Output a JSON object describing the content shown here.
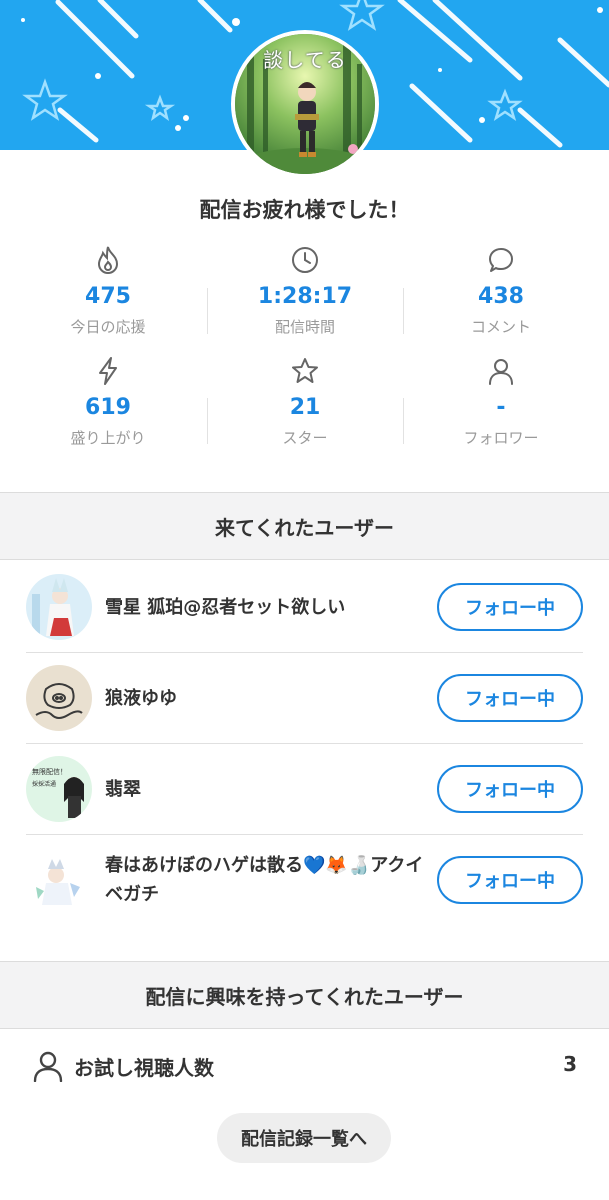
{
  "header": {
    "avatar_caption": "談してる",
    "title": "配信お疲れ様でした！"
  },
  "stats": [
    {
      "icon": "flame-icon",
      "value": "475",
      "label": "今日の応援"
    },
    {
      "icon": "clock-icon",
      "value": "1:28:17",
      "label": "配信時間"
    },
    {
      "icon": "comment-icon",
      "value": "438",
      "label": "コメント"
    },
    {
      "icon": "lightning-icon",
      "value": "619",
      "label": "盛り上がり"
    },
    {
      "icon": "star-icon",
      "value": "21",
      "label": "スター"
    },
    {
      "icon": "person-icon",
      "value": "-",
      "label": "フォロワー"
    }
  ],
  "visitors_section": {
    "title": "来てくれたユーザー",
    "users": [
      {
        "name": "雪星 狐珀@忍者セット欲しい",
        "button": "フォロー中"
      },
      {
        "name": "狼液ゆゆ",
        "button": "フォロー中"
      },
      {
        "name": "翡翠",
        "button": "フォロー中",
        "avatar_text_1": "無限配信！",
        "avatar_text_2": "採採活通"
      },
      {
        "name": "春はあけぼのハゲは散る💙🦊🍶アクイベガチ",
        "button": "フォロー中"
      }
    ]
  },
  "interest_section": {
    "title": "配信に興味を持ってくれたユーザー",
    "trial_label": "お試し視聴人数",
    "trial_count": "3"
  },
  "history_button": "配信記録一覧へ",
  "colors": {
    "accent": "#1b86e0",
    "banner": "#22a6f0"
  }
}
